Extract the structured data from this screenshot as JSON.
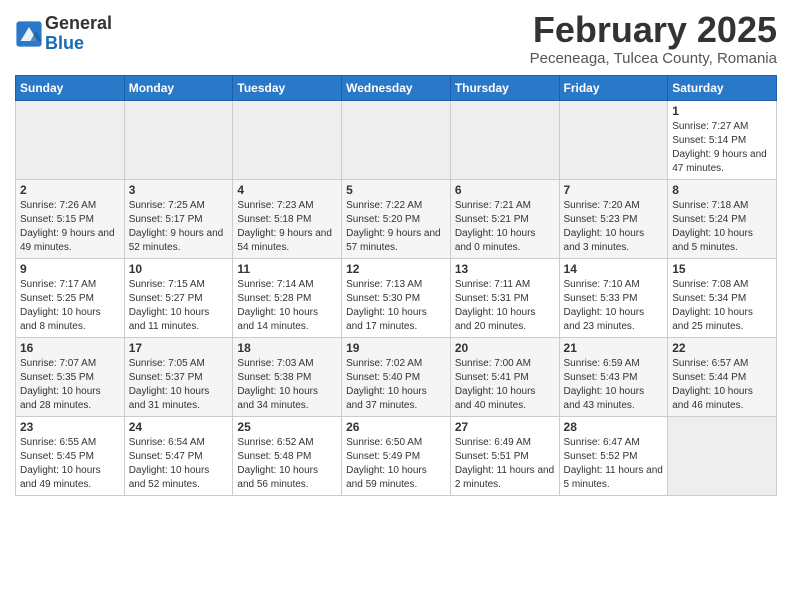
{
  "header": {
    "logo_general": "General",
    "logo_blue": "Blue",
    "month_title": "February 2025",
    "location": "Peceneaga, Tulcea County, Romania"
  },
  "weekdays": [
    "Sunday",
    "Monday",
    "Tuesday",
    "Wednesday",
    "Thursday",
    "Friday",
    "Saturday"
  ],
  "weeks": [
    [
      {
        "day": "",
        "info": ""
      },
      {
        "day": "",
        "info": ""
      },
      {
        "day": "",
        "info": ""
      },
      {
        "day": "",
        "info": ""
      },
      {
        "day": "",
        "info": ""
      },
      {
        "day": "",
        "info": ""
      },
      {
        "day": "1",
        "info": "Sunrise: 7:27 AM\nSunset: 5:14 PM\nDaylight: 9 hours and 47 minutes."
      }
    ],
    [
      {
        "day": "2",
        "info": "Sunrise: 7:26 AM\nSunset: 5:15 PM\nDaylight: 9 hours and 49 minutes."
      },
      {
        "day": "3",
        "info": "Sunrise: 7:25 AM\nSunset: 5:17 PM\nDaylight: 9 hours and 52 minutes."
      },
      {
        "day": "4",
        "info": "Sunrise: 7:23 AM\nSunset: 5:18 PM\nDaylight: 9 hours and 54 minutes."
      },
      {
        "day": "5",
        "info": "Sunrise: 7:22 AM\nSunset: 5:20 PM\nDaylight: 9 hours and 57 minutes."
      },
      {
        "day": "6",
        "info": "Sunrise: 7:21 AM\nSunset: 5:21 PM\nDaylight: 10 hours and 0 minutes."
      },
      {
        "day": "7",
        "info": "Sunrise: 7:20 AM\nSunset: 5:23 PM\nDaylight: 10 hours and 3 minutes."
      },
      {
        "day": "8",
        "info": "Sunrise: 7:18 AM\nSunset: 5:24 PM\nDaylight: 10 hours and 5 minutes."
      }
    ],
    [
      {
        "day": "9",
        "info": "Sunrise: 7:17 AM\nSunset: 5:25 PM\nDaylight: 10 hours and 8 minutes."
      },
      {
        "day": "10",
        "info": "Sunrise: 7:15 AM\nSunset: 5:27 PM\nDaylight: 10 hours and 11 minutes."
      },
      {
        "day": "11",
        "info": "Sunrise: 7:14 AM\nSunset: 5:28 PM\nDaylight: 10 hours and 14 minutes."
      },
      {
        "day": "12",
        "info": "Sunrise: 7:13 AM\nSunset: 5:30 PM\nDaylight: 10 hours and 17 minutes."
      },
      {
        "day": "13",
        "info": "Sunrise: 7:11 AM\nSunset: 5:31 PM\nDaylight: 10 hours and 20 minutes."
      },
      {
        "day": "14",
        "info": "Sunrise: 7:10 AM\nSunset: 5:33 PM\nDaylight: 10 hours and 23 minutes."
      },
      {
        "day": "15",
        "info": "Sunrise: 7:08 AM\nSunset: 5:34 PM\nDaylight: 10 hours and 25 minutes."
      }
    ],
    [
      {
        "day": "16",
        "info": "Sunrise: 7:07 AM\nSunset: 5:35 PM\nDaylight: 10 hours and 28 minutes."
      },
      {
        "day": "17",
        "info": "Sunrise: 7:05 AM\nSunset: 5:37 PM\nDaylight: 10 hours and 31 minutes."
      },
      {
        "day": "18",
        "info": "Sunrise: 7:03 AM\nSunset: 5:38 PM\nDaylight: 10 hours and 34 minutes."
      },
      {
        "day": "19",
        "info": "Sunrise: 7:02 AM\nSunset: 5:40 PM\nDaylight: 10 hours and 37 minutes."
      },
      {
        "day": "20",
        "info": "Sunrise: 7:00 AM\nSunset: 5:41 PM\nDaylight: 10 hours and 40 minutes."
      },
      {
        "day": "21",
        "info": "Sunrise: 6:59 AM\nSunset: 5:43 PM\nDaylight: 10 hours and 43 minutes."
      },
      {
        "day": "22",
        "info": "Sunrise: 6:57 AM\nSunset: 5:44 PM\nDaylight: 10 hours and 46 minutes."
      }
    ],
    [
      {
        "day": "23",
        "info": "Sunrise: 6:55 AM\nSunset: 5:45 PM\nDaylight: 10 hours and 49 minutes."
      },
      {
        "day": "24",
        "info": "Sunrise: 6:54 AM\nSunset: 5:47 PM\nDaylight: 10 hours and 52 minutes."
      },
      {
        "day": "25",
        "info": "Sunrise: 6:52 AM\nSunset: 5:48 PM\nDaylight: 10 hours and 56 minutes."
      },
      {
        "day": "26",
        "info": "Sunrise: 6:50 AM\nSunset: 5:49 PM\nDaylight: 10 hours and 59 minutes."
      },
      {
        "day": "27",
        "info": "Sunrise: 6:49 AM\nSunset: 5:51 PM\nDaylight: 11 hours and 2 minutes."
      },
      {
        "day": "28",
        "info": "Sunrise: 6:47 AM\nSunset: 5:52 PM\nDaylight: 11 hours and 5 minutes."
      },
      {
        "day": "",
        "info": ""
      }
    ]
  ]
}
